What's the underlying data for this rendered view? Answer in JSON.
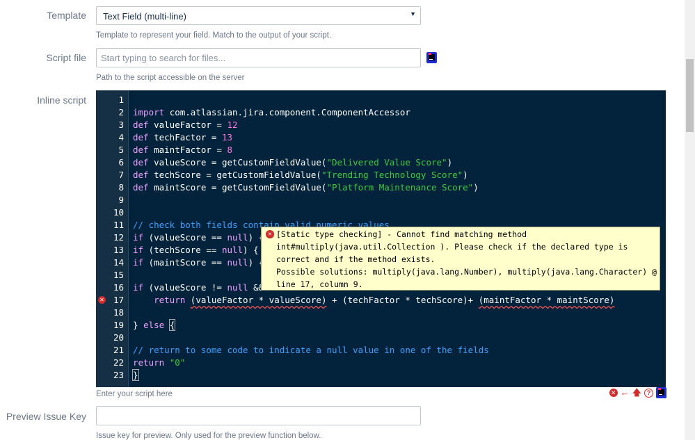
{
  "template": {
    "label": "Template",
    "value": "Text Field (multi-line)",
    "help": "Template to represent your field. Match to the output of your script."
  },
  "script_file": {
    "label": "Script file",
    "placeholder": "Start typing to search for files...",
    "help": "Path to the script accessible on the server"
  },
  "inline_script": {
    "label": "Inline script",
    "help": "Enter your script here",
    "line_numbers": [
      "1",
      "2",
      "3",
      "4",
      "5",
      "6",
      "7",
      "8",
      "9",
      "10",
      "11",
      "12",
      "13",
      "14",
      "15",
      "16",
      "17",
      "18",
      "19",
      "20",
      "21",
      "22",
      "23"
    ],
    "code": {
      "l2a": "import ",
      "l2b": "com.atlassian.jira.component.ComponentAccessor",
      "l3a": "def ",
      "l3b": "valueFactor = ",
      "l3c": "12",
      "l4a": "def ",
      "l4b": "techFactor = ",
      "l4c": "13",
      "l5a": "def ",
      "l5b": "maintFactor = ",
      "l5c": "8",
      "l6a": "def ",
      "l6b": "valueScore = getCustomFieldValue(",
      "l6c": "\"Delivered Value Score\"",
      "l6d": ")",
      "l7a": "def ",
      "l7b": "techScore = getCustomFieldValue(",
      "l7c": "\"Trending Technology Score\"",
      "l7d": ")",
      "l8a": "def ",
      "l8b": "maintScore = getCustomFieldValue(",
      "l8c": "\"Platform Maintenance Score\"",
      "l8d": ")",
      "l11": "// check both fields contain valid numeric values",
      "l12a": "if ",
      "l12b": "(valueScore == ",
      "l12c": "null",
      "l12d": ") {",
      "l13a": "if ",
      "l13b": "(techScore == ",
      "l13c": "null",
      "l13d": ") { ",
      "l14a": "if ",
      "l14b": "(maintScore == ",
      "l14c": "null",
      "l14d": ") {",
      "l16a": "if ",
      "l16b": "(valueScore != ",
      "l16c": "null",
      "l16d": " &&",
      "l17a": "    return ",
      "l17b": "(valueFactor * valueScore)",
      "l17c": " + ",
      "l17d": "(techFactor * techScore)",
      "l17e": "+ ",
      "l17f": "(maintFactor * maintScore)",
      "l19a": "} ",
      "l19b": "else ",
      "l19c": "{",
      "l21": "// return to some code to indicate a null value in one of the fields",
      "l22a": "return ",
      "l22b": "\"0\"",
      "l23": "}"
    },
    "tooltip": {
      "line1": "[Static type checking] - Cannot find matching method",
      "line2": "int#multiply(java.util.Collection ). Please check if the declared type is",
      "line3": "correct and if the method exists.",
      "line4": "Possible solutions: multiply(java.lang.Number), multiply(java.lang.Character) @",
      "line5": "line 17, column 9."
    }
  },
  "preview_issue_key": {
    "label": "Preview Issue Key",
    "value": "",
    "help": "Issue key for preview. Only used for the preview function below."
  },
  "colors": {
    "editor_bg": "#02233b",
    "error_red": "#d42a2a",
    "tooltip_bg": "#ffffcc"
  }
}
